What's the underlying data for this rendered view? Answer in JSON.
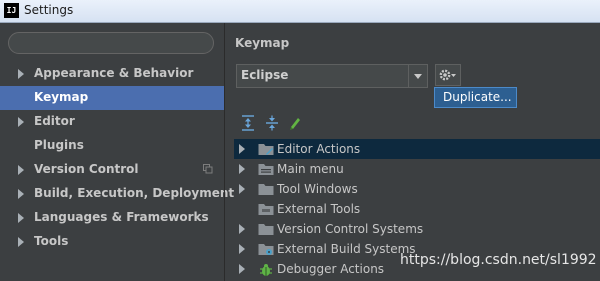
{
  "window": {
    "app_icon_text": "IJ",
    "title": "Settings"
  },
  "search": {
    "value": ""
  },
  "sidebar": {
    "items": [
      {
        "label": "Appearance & Behavior",
        "expandable": true
      },
      {
        "label": "Keymap",
        "expandable": false,
        "selected": true
      },
      {
        "label": "Editor",
        "expandable": true
      },
      {
        "label": "Plugins",
        "expandable": false
      },
      {
        "label": "Version Control",
        "expandable": true
      },
      {
        "label": "Build, Execution, Deployment",
        "expandable": true
      },
      {
        "label": "Languages & Frameworks",
        "expandable": true
      },
      {
        "label": "Tools",
        "expandable": true
      }
    ]
  },
  "main": {
    "title": "Keymap",
    "keymap_select": {
      "value": "Eclipse"
    },
    "gear_menu": {
      "item": "Duplicate..."
    },
    "tree": [
      {
        "label": "Editor Actions",
        "icon": "folder-edit-icon"
      },
      {
        "label": "Main menu",
        "icon": "folder-menu-icon"
      },
      {
        "label": "Tool Windows",
        "icon": "folder-icon"
      },
      {
        "label": "External Tools",
        "icon": "folder-tools-icon"
      },
      {
        "label": "Version Control Systems",
        "icon": "folder-icon"
      },
      {
        "label": "External Build Systems",
        "icon": "folder-gear-icon"
      },
      {
        "label": "Debugger Actions",
        "icon": "bug-icon"
      }
    ]
  },
  "watermark": "https://blog.csdn.net/sl1992"
}
